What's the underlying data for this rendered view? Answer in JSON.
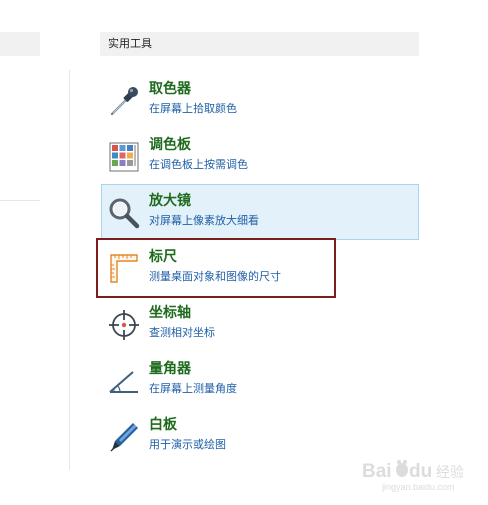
{
  "section": {
    "title": "实用工具"
  },
  "tools": [
    {
      "name": "取色器",
      "description": "在屏幕上拾取颜色",
      "icon": "eyedropper-icon",
      "selected": false
    },
    {
      "name": "调色板",
      "description": "在调色板上按需调色",
      "icon": "palette-grid-icon",
      "selected": false
    },
    {
      "name": "放大镜",
      "description": "对屏幕上像素放大细看",
      "icon": "magnifier-icon",
      "selected": true
    },
    {
      "name": "标尺",
      "description": "测量桌面对象和图像的尺寸",
      "icon": "ruler-icon",
      "selected": false
    },
    {
      "name": "坐标轴",
      "description": "查测相对坐标",
      "icon": "crosshair-icon",
      "selected": false
    },
    {
      "name": "量角器",
      "description": "在屏幕上测量角度",
      "icon": "protractor-icon",
      "selected": false
    },
    {
      "name": "白板",
      "description": "用于演示或绘图",
      "icon": "pen-icon",
      "selected": false
    }
  ],
  "colors": {
    "title_text": "#1e6b1e",
    "description_text": "#1f5fa6",
    "selected_background": "#e3f1fa",
    "selected_border": "#a9d4ef",
    "annotation_box": "#7c1d1d"
  },
  "watermark": {
    "text": "Baidu 经验",
    "url": "jingyan.baidu.com"
  }
}
